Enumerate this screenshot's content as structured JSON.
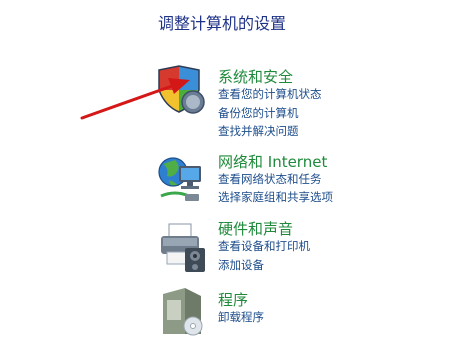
{
  "page": {
    "title": "调整计算机的设置"
  },
  "categories": [
    {
      "title": "系统和安全",
      "icon": "shield-icon",
      "links": [
        "查看您的计算机状态",
        "备份您的计算机",
        "查找并解决问题"
      ]
    },
    {
      "title": "网络和 Internet",
      "icon": "network-globe-icon",
      "links": [
        "查看网络状态和任务",
        "选择家庭组和共享选项"
      ]
    },
    {
      "title": "硬件和声音",
      "icon": "printer-icon",
      "links": [
        "查看设备和打印机",
        "添加设备"
      ]
    },
    {
      "title": "程序",
      "icon": "programs-box-icon",
      "links": [
        "卸载程序"
      ]
    }
  ],
  "colors": {
    "title_blue": "#1e3287",
    "category_green": "#1f8a3b",
    "link_blue": "#1e4e8c",
    "annotation_red": "#d41818"
  }
}
